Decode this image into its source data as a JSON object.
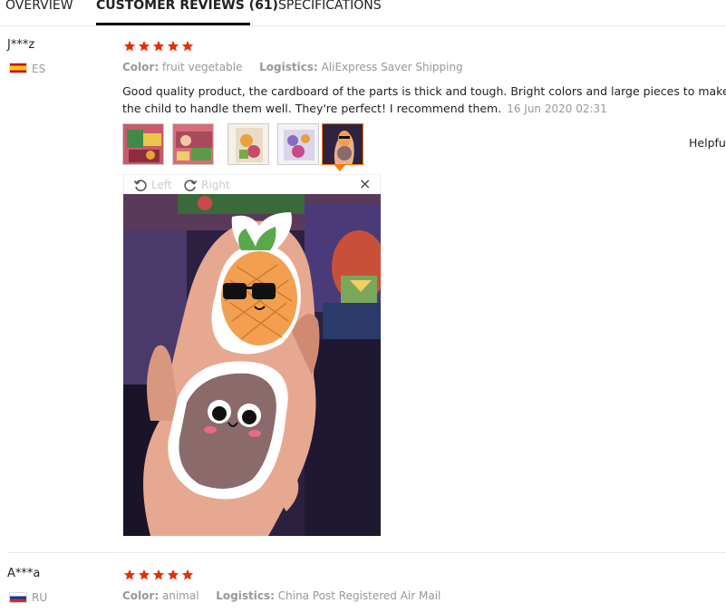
{
  "tabs": [
    {
      "label": "OVERVIEW"
    },
    {
      "label": "CUSTOMER REVIEWS (61)"
    },
    {
      "label": "SPECIFICATIONS"
    }
  ],
  "reviews": [
    {
      "user": "J***z",
      "country": "ES",
      "rating": 5,
      "color_key": "Color:",
      "color_val": "fruit vegetable",
      "logistics_key": "Logistics:",
      "logistics_val": "AliExpress Saver Shipping",
      "text_line1": "Good quality product, the cardboard of the parts is thick and tough. Bright colors and large pieces to make it easier for",
      "text_line2": "the child to handle them well. They're perfect! I recommend them.",
      "date": "16 Jun 2020 02:31",
      "helpful_label": "Helpful?",
      "photo_count": 5,
      "selected_photo": 4
    },
    {
      "user": "A***a",
      "country": "RU",
      "rating": 5,
      "color_key": "Color:",
      "color_val": "animal",
      "logistics_key": "Logistics:",
      "logistics_val": "China Post Registered Air Mail"
    }
  ],
  "viewer": {
    "rotate_left": "Left",
    "rotate_right": "Right",
    "close": "×"
  },
  "colors": {
    "star": "#e62e04",
    "thumb_selected": "#ff7a00",
    "muted": "#999999"
  },
  "icons": [
    "star-icon",
    "rotate-left-icon",
    "rotate-right-icon",
    "close-icon",
    "flag-es-icon",
    "flag-ru-icon"
  ]
}
